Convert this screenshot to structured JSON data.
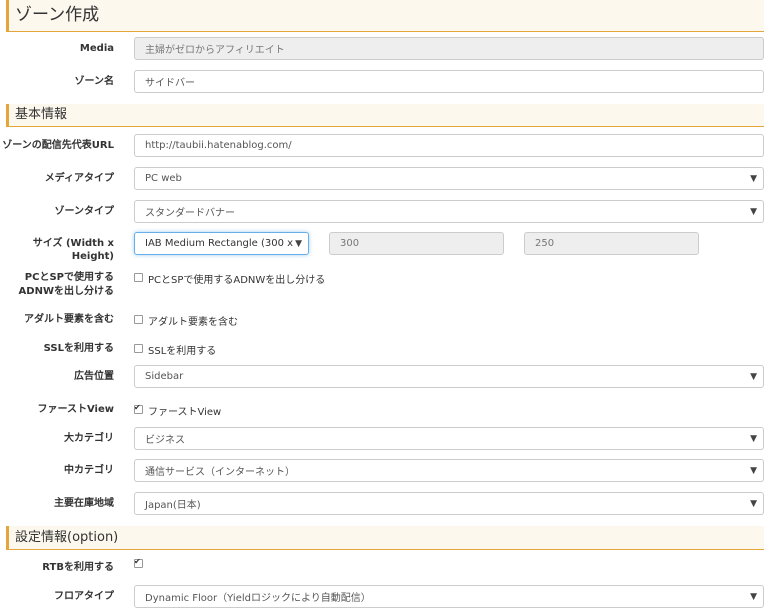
{
  "sections": {
    "zone_create": "ゾーン作成",
    "basic_info": "基本情報",
    "settings": "設定情報(option)"
  },
  "fields": {
    "media": {
      "label": "Media",
      "value": "主婦がゼロからアフィリエイト"
    },
    "zone_name": {
      "label": "ゾーン名",
      "value": "サイドバー"
    },
    "url": {
      "label": "ゾーンの配信先代表URL",
      "value": "http://taubii.hatenablog.com/"
    },
    "media_type": {
      "label": "メディアタイプ",
      "value": "PC web"
    },
    "zone_type": {
      "label": "ゾーンタイプ",
      "value": "スタンダードバナー"
    },
    "size": {
      "label": "サイズ (Width x Height)",
      "value": "IAB Medium Rectangle (300 x",
      "width": "300",
      "height": "250"
    },
    "pc_sp": {
      "label_line1": "PCとSPで使用する",
      "label_line2": "ADNWを出し分ける",
      "check_label": "PCとSPで使用するADNWを出し分ける",
      "checked": false
    },
    "adult": {
      "label": "アダルト要素を含む",
      "check_label": "アダルト要素を含む",
      "checked": false
    },
    "ssl": {
      "label": "SSLを利用する",
      "check_label": "SSLを利用する",
      "checked": false
    },
    "ad_position": {
      "label": "広告位置",
      "value": "Sidebar"
    },
    "first_view": {
      "label": "ファーストView",
      "check_label": "ファーストView",
      "checked": true
    },
    "category_large": {
      "label": "大カテゴリ",
      "value": "ビジネス"
    },
    "category_mid": {
      "label": "中カテゴリ",
      "value": "通信サービス（インターネット）"
    },
    "region": {
      "label": "主要在庫地域",
      "value": "Japan(日本)"
    },
    "rtb": {
      "label": "RTBを利用する",
      "checked": true
    },
    "floor_type": {
      "label": "フロアタイプ",
      "value": "Dynamic Floor（Yieldロジックにより自動配信）"
    }
  },
  "icons": {
    "caret": "▼"
  }
}
